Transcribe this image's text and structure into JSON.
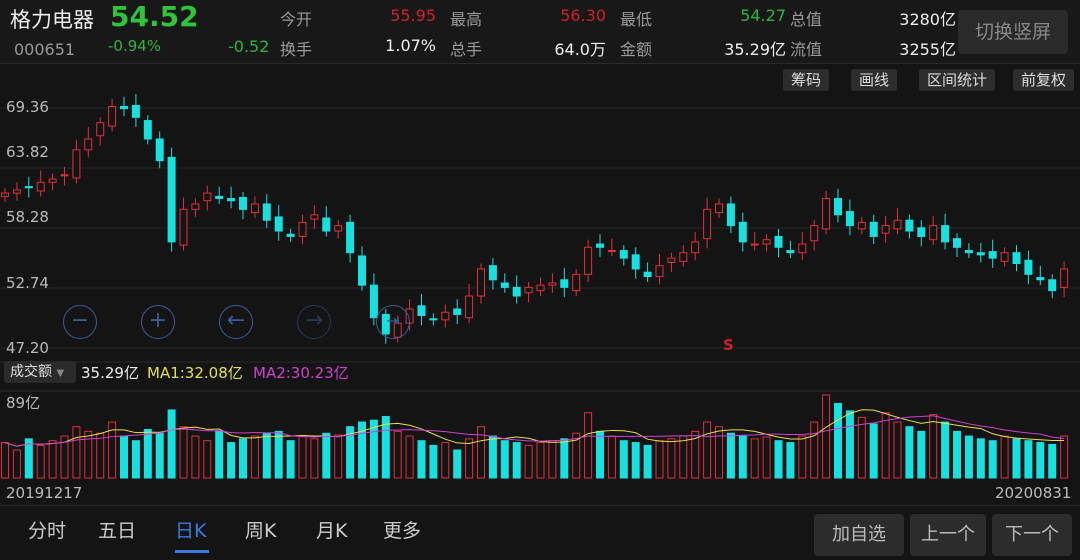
{
  "header": {
    "name": "格力电器",
    "price": "54.52",
    "code": "000651",
    "change_pct": "-0.94%",
    "change": "-0.52",
    "stats": [
      {
        "label": "今开",
        "value": "55.95",
        "color": "red"
      },
      {
        "label": "最高",
        "value": "56.30",
        "color": "red"
      },
      {
        "label": "最低",
        "value": "54.27",
        "color": "green"
      },
      {
        "label": "总值",
        "value": "3280亿",
        "color": "white"
      },
      {
        "label": "换手",
        "value": "1.07%",
        "color": "white"
      },
      {
        "label": "总手",
        "value": "64.0万",
        "color": "white"
      },
      {
        "label": "金额",
        "value": "35.29亿",
        "color": "white"
      },
      {
        "label": "流值",
        "value": "3255亿",
        "color": "white"
      }
    ],
    "switch_label": "切换竖屏"
  },
  "toolbar": [
    "筹码",
    "画线",
    "区间统计",
    "前复权"
  ],
  "price_axis": [
    "69.36",
    "63.82",
    "58.28",
    "52.74",
    "47.20"
  ],
  "signal": "S",
  "volume": {
    "selector": "成交额",
    "value": "35.29亿",
    "ma1": "MA1:32.08亿",
    "ma2": "MA2:30.23亿",
    "max_label": "89亿"
  },
  "dates": {
    "start": "20191217",
    "end": "20200831"
  },
  "tabs": [
    "分时",
    "五日",
    "日K",
    "周K",
    "月K",
    "更多"
  ],
  "active_tab": 2,
  "buttons": {
    "add": "加自选",
    "prev": "上一个",
    "next": "下一个"
  },
  "colors": {
    "up": "#e0303a",
    "down": "#19e0e0",
    "ma1": "#e8e04a",
    "ma2": "#d040d0",
    "accent": "#3b7be0"
  },
  "chart_data": {
    "type": "candlestick",
    "ylim": [
      47.2,
      69.36
    ],
    "vol_max": 89,
    "close": [
      61.5,
      61.8,
      62.0,
      62.5,
      62.8,
      63.2,
      65.5,
      66.5,
      68.0,
      69.5,
      69.3,
      68.5,
      66.5,
      64.5,
      57.0,
      60.0,
      60.5,
      61.5,
      61.0,
      60.8,
      60.0,
      60.5,
      59.0,
      58.0,
      57.5,
      58.8,
      59.5,
      58.0,
      58.5,
      56.0,
      53.0,
      50.0,
      48.5,
      49.5,
      50.8,
      50.2,
      49.8,
      50.5,
      50.3,
      52.0,
      54.5,
      53.5,
      52.8,
      52.0,
      52.8,
      53.0,
      53.2,
      52.8,
      54.0,
      56.5,
      56.5,
      56.2,
      55.5,
      54.5,
      53.8,
      54.8,
      55.5,
      56.0,
      57.0,
      60.0,
      60.5,
      58.5,
      57.0,
      56.8,
      57.2,
      56.5,
      56.0,
      56.8,
      58.5,
      61.0,
      59.5,
      58.5,
      58.8,
      57.5,
      58.5,
      59.0,
      58.0,
      57.5,
      58.5,
      57.0,
      56.5,
      56.0,
      55.8,
      55.5,
      56.0,
      55.0,
      54.0,
      53.5,
      52.5,
      54.5
    ],
    "volume": [
      38,
      30,
      42,
      35,
      40,
      45,
      55,
      50,
      48,
      60,
      45,
      40,
      52,
      48,
      73,
      55,
      45,
      40,
      50,
      38,
      42,
      45,
      48,
      50,
      40,
      45,
      42,
      48,
      46,
      55,
      60,
      62,
      66,
      50,
      45,
      40,
      35,
      38,
      30,
      42,
      55,
      45,
      40,
      38,
      35,
      38,
      40,
      42,
      48,
      70,
      50,
      45,
      40,
      38,
      35,
      40,
      42,
      45,
      50,
      60,
      55,
      48,
      45,
      42,
      44,
      40,
      38,
      45,
      60,
      89,
      80,
      72,
      65,
      58,
      70,
      60,
      55,
      50,
      68,
      60,
      50,
      45,
      42,
      40,
      45,
      42,
      40,
      38,
      36,
      45
    ]
  }
}
